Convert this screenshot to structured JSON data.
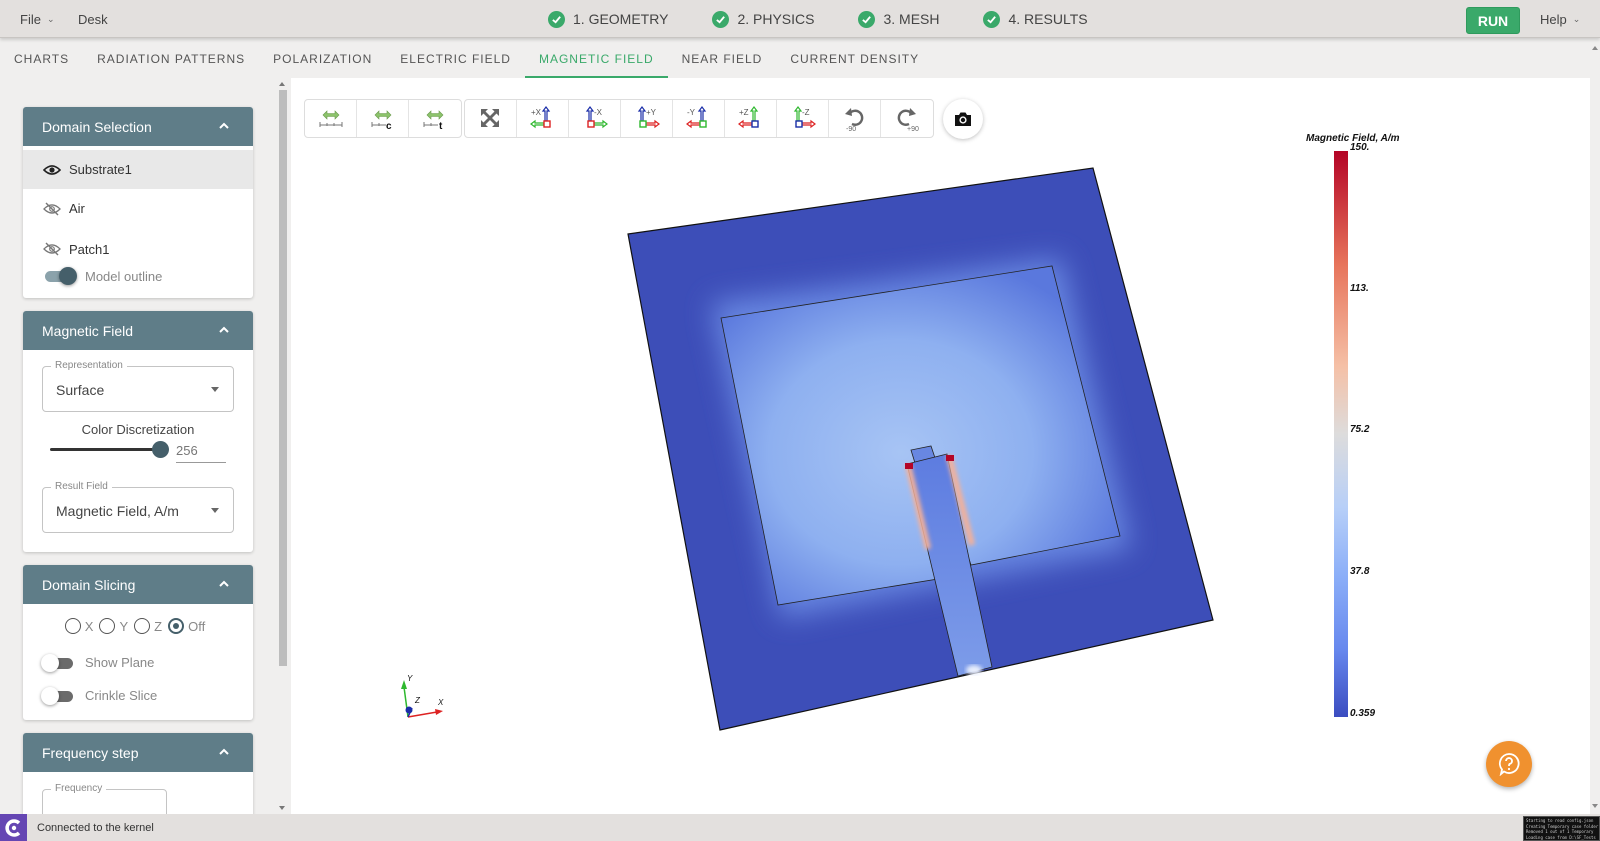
{
  "topbar": {
    "file_menu": "File",
    "desk_menu": "Desk",
    "steps": [
      {
        "label": "1. GEOMETRY",
        "status": "complete"
      },
      {
        "label": "2. PHYSICS",
        "status": "complete"
      },
      {
        "label": "3. MESH",
        "status": "complete"
      },
      {
        "label": "4. RESULTS",
        "status": "complete"
      }
    ],
    "run_label": "RUN",
    "help_menu": "Help"
  },
  "tabs": [
    {
      "label": "CHARTS",
      "active": false
    },
    {
      "label": "RADIATION PATTERNS",
      "active": false
    },
    {
      "label": "POLARIZATION",
      "active": false
    },
    {
      "label": "ELECTRIC FIELD",
      "active": false
    },
    {
      "label": "MAGNETIC FIELD",
      "active": true
    },
    {
      "label": "NEAR FIELD",
      "active": false
    },
    {
      "label": "CURRENT DENSITY",
      "active": false
    }
  ],
  "sidebar": {
    "domain_selection": {
      "title": "Domain Selection",
      "items": [
        {
          "label": "Substrate1",
          "visible": true,
          "selected": true
        },
        {
          "label": "Air",
          "visible": false,
          "selected": false
        },
        {
          "label": "Patch1",
          "visible": false,
          "selected": false
        }
      ],
      "model_outline": {
        "label": "Model outline",
        "on": true
      }
    },
    "magnetic_field": {
      "title": "Magnetic Field",
      "representation": {
        "legend": "Representation",
        "value": "Surface"
      },
      "color_discretization": {
        "label": "Color Discretization",
        "value": "256",
        "fraction": 1.0
      },
      "result_field": {
        "legend": "Result Field",
        "value": "Magnetic Field, A/m"
      }
    },
    "domain_slicing": {
      "title": "Domain Slicing",
      "options": [
        "X",
        "Y",
        "Z",
        "Off"
      ],
      "selected": "Off",
      "show_plane": {
        "label": "Show Plane",
        "on": false
      },
      "crinkle_slice": {
        "label": "Crinkle Slice",
        "on": false
      }
    },
    "frequency_step": {
      "title": "Frequency step",
      "frequency_legend": "Frequency"
    }
  },
  "toolbar": {
    "buttons": [
      {
        "name": "measure-ruler",
        "label": ""
      },
      {
        "name": "measure-ruler-c",
        "label": "c"
      },
      {
        "name": "measure-ruler-t",
        "label": "t"
      },
      {
        "name": "fit-view",
        "label": ""
      },
      {
        "name": "view-plus-x",
        "label": "+X"
      },
      {
        "name": "view-minus-x",
        "label": "-X"
      },
      {
        "name": "view-plus-y",
        "label": "+Y"
      },
      {
        "name": "view-minus-y",
        "label": "-Y"
      },
      {
        "name": "view-plus-z",
        "label": "+Z"
      },
      {
        "name": "view-minus-z",
        "label": "-Z"
      },
      {
        "name": "rotate-minus-90",
        "label": "-90"
      },
      {
        "name": "rotate-plus-90",
        "label": "+90"
      }
    ]
  },
  "colorbar": {
    "title": "Magnetic Field, A/m",
    "ticks": [
      "150.",
      "113.",
      "75.2",
      "37.8",
      "0.359"
    ],
    "max": 150,
    "min": 0.359
  },
  "axes_triad": {
    "x": "X",
    "y": "Y",
    "z": "Z"
  },
  "status": {
    "text": "Connected to the kernel",
    "console_lines": [
      "Starting to read config.json",
      "Creating Temporary case folder",
      "Removed 1 out of 1 Temporary",
      "Loading case from D:\\SF_Tests"
    ]
  },
  "colors": {
    "accent": "#3aa96a",
    "panel_header": "#5f7d88",
    "help_fab": "#f0912f",
    "logo": "#6546b3"
  }
}
